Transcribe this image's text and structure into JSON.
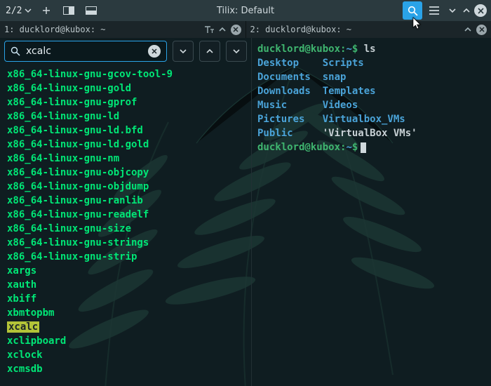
{
  "titlebar": {
    "session": "2/2",
    "title": "Tilix: Default"
  },
  "panes": {
    "left_label": "1: ducklord@kubox: ~",
    "right_label": "2: ducklord@kubox: ~"
  },
  "search": {
    "query": "xcalc"
  },
  "left_lines": [
    "x86_64-linux-gnu-gcov-tool-9",
    "x86_64-linux-gnu-gold",
    "x86_64-linux-gnu-gprof",
    "x86_64-linux-gnu-ld",
    "x86_64-linux-gnu-ld.bfd",
    "x86_64-linux-gnu-ld.gold",
    "x86_64-linux-gnu-nm",
    "x86_64-linux-gnu-objcopy",
    "x86_64-linux-gnu-objdump",
    "x86_64-linux-gnu-ranlib",
    "x86_64-linux-gnu-readelf",
    "x86_64-linux-gnu-size",
    "x86_64-linux-gnu-strings",
    "x86_64-linux-gnu-strip",
    "xargs",
    "xauth",
    "xbiff",
    "xbmtopbm",
    "xcalc",
    "xclipboard",
    "xclock",
    "xcmsdb"
  ],
  "left_highlight": "xcalc",
  "right_term": {
    "prompt_user": "ducklord@kubox",
    "prompt_path": "~",
    "cmd": "ls",
    "rows": [
      [
        "Desktop",
        "Scripts"
      ],
      [
        "Documents",
        "snap"
      ],
      [
        "Downloads",
        "Templates"
      ],
      [
        "Music",
        "Videos"
      ],
      [
        "Pictures",
        "Virtualbox_VMs"
      ],
      [
        "Public",
        "'VirtualBox VMs'"
      ]
    ]
  }
}
